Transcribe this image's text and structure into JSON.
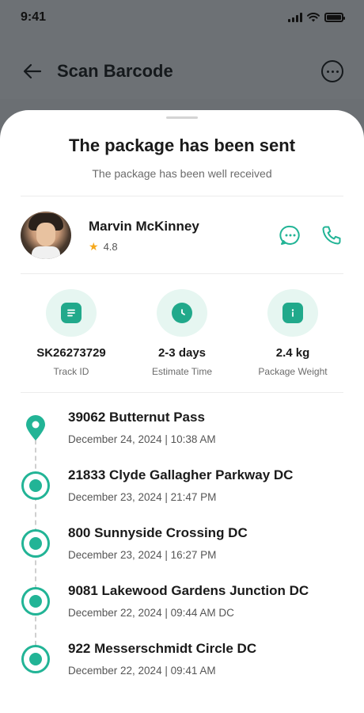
{
  "status_bar": {
    "time": "9:41"
  },
  "header": {
    "title": "Scan Barcode"
  },
  "sheet": {
    "title": "The package has been sent",
    "subtitle": "The package has been well received"
  },
  "driver": {
    "name": "Marvin McKinney",
    "rating": "4.8"
  },
  "stats": [
    {
      "value": "SK26273729",
      "label": "Track ID",
      "icon": "document-icon"
    },
    {
      "value": "2-3 days",
      "label": "Estimate Time",
      "icon": "clock-icon"
    },
    {
      "value": "2.4 kg",
      "label": "Package Weight",
      "icon": "info-icon"
    }
  ],
  "timeline": [
    {
      "title": "39062 Butternut Pass",
      "date": "December 24, 2024 | 10:38 AM"
    },
    {
      "title": "21833 Clyde Gallagher Parkway DC",
      "date": "December 23, 2024 | 21:47 PM"
    },
    {
      "title": "800 Sunnyside Crossing DC",
      "date": "December 23, 2024 | 16:27 PM"
    },
    {
      "title": "9081 Lakewood Gardens Junction DC",
      "date": "December 22, 2024 | 09:44 AM DC"
    },
    {
      "title": "922 Messerschmidt Circle DC",
      "date": "December 22, 2024 | 09:41 AM"
    }
  ],
  "colors": {
    "accent": "#22b496",
    "accent_light": "#e6f6f1",
    "overlay": "#6d7175"
  }
}
